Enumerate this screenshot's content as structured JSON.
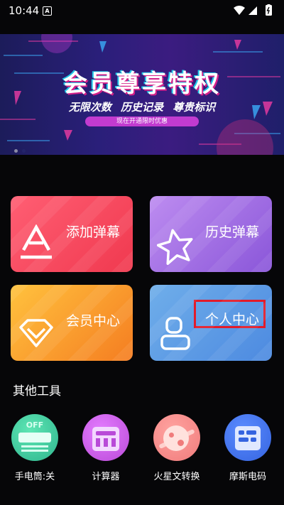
{
  "status_bar": {
    "time": "10:44",
    "notification_glyph": "A"
  },
  "banner": {
    "title": "会员尊享特权",
    "subtitle": "无限次数  历史记录  尊贵标识",
    "badge": "现在开通限时优惠"
  },
  "cards": [
    {
      "label": "添加弹幕",
      "icon": "letter-a-icon",
      "color": "#f0394f"
    },
    {
      "label": "历史弹幕",
      "icon": "star-icon",
      "color": "#8a56d9"
    },
    {
      "label": "会员中心",
      "icon": "diamond-icon",
      "color": "#f57d21"
    },
    {
      "label": "个人中心",
      "icon": "user-icon",
      "color": "#4d8ae0"
    }
  ],
  "other_tools": {
    "title": "其他工具",
    "items": [
      {
        "label": "手电筒:关",
        "icon": "flashlight-icon",
        "icon_text": "OFF"
      },
      {
        "label": "计算器",
        "icon": "calculator-icon"
      },
      {
        "label": "火星文转换",
        "icon": "mars-text-icon"
      },
      {
        "label": "摩斯电码",
        "icon": "morse-code-icon"
      }
    ]
  }
}
